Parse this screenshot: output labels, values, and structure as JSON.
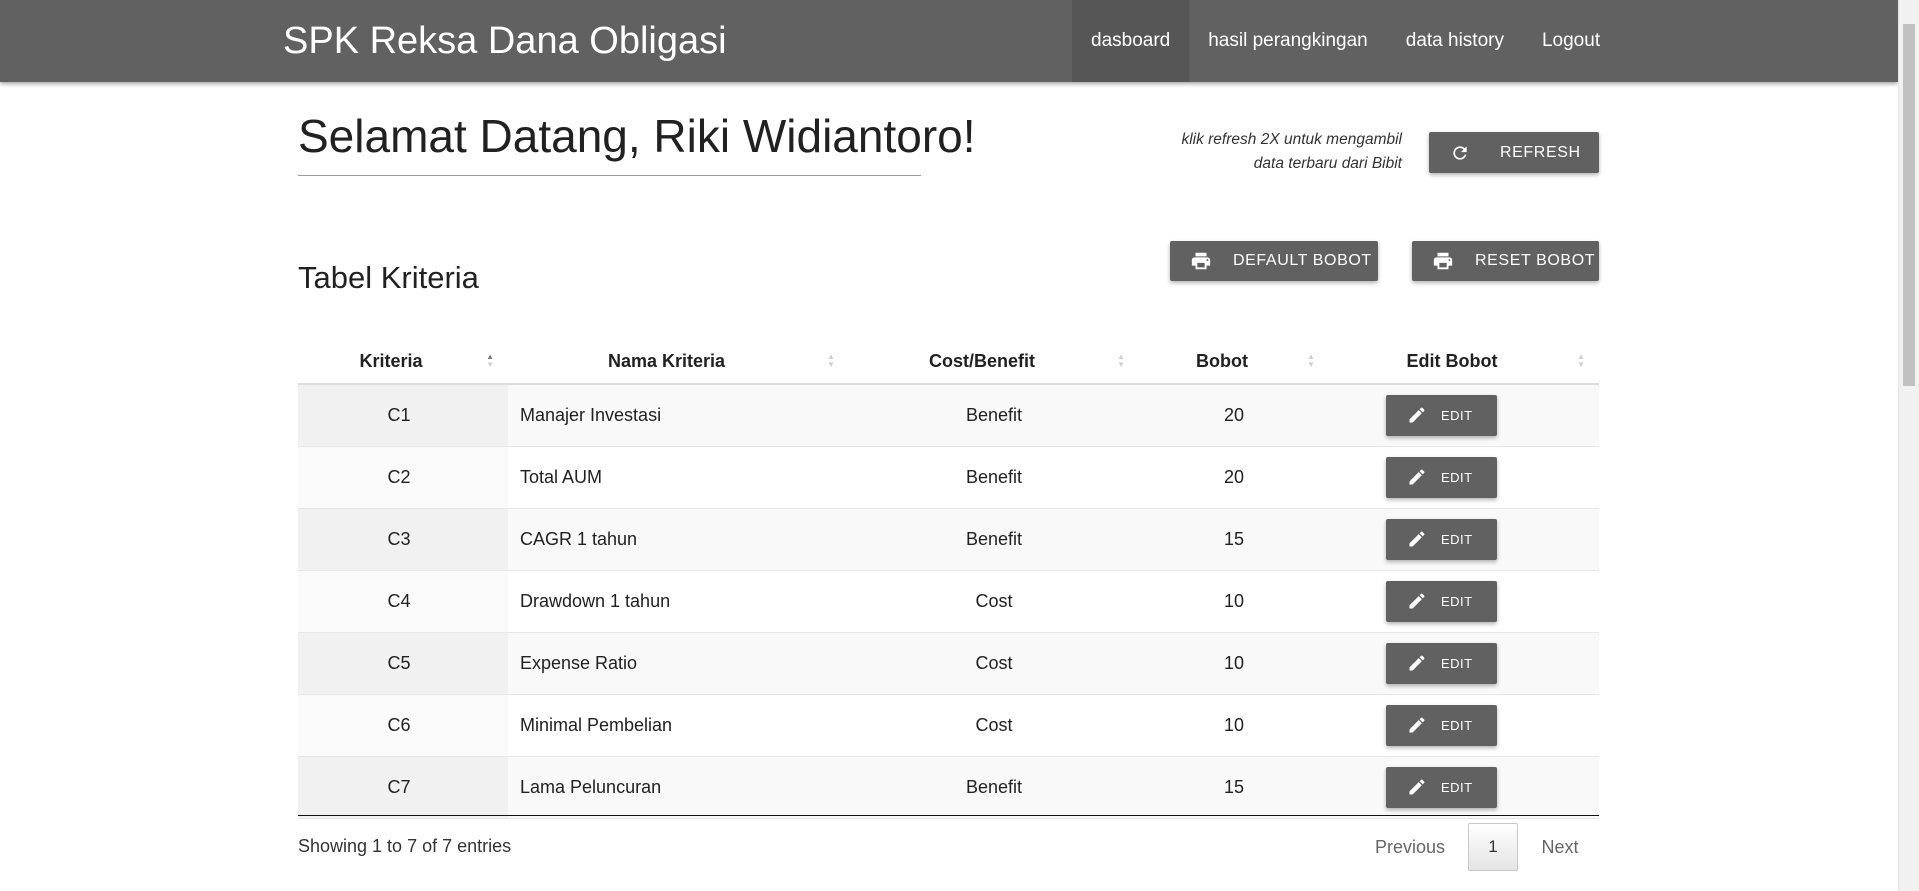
{
  "navbar": {
    "brand": "SPK Reksa Dana Obligasi",
    "items": [
      {
        "label": "dasboard",
        "active": true
      },
      {
        "label": "hasil perangkingan",
        "active": false
      },
      {
        "label": "data history",
        "active": false
      },
      {
        "label": "Logout",
        "active": false
      }
    ]
  },
  "welcome": {
    "title": "Selamat Datang, Riki Widiantoro!"
  },
  "refresh": {
    "note_line1": "klik refresh 2X untuk mengambil",
    "note_line2": "data terbaru dari Bibit",
    "button_label": "REFRESH",
    "icon": "refresh-icon"
  },
  "bobot_buttons": {
    "default_label": "DEFAULT BOBOT",
    "reset_label": "RESET BOBOT",
    "icon": "print-icon"
  },
  "section": {
    "title": "Tabel Kriteria"
  },
  "table": {
    "headers": [
      "Kriteria",
      "Nama Kriteria",
      "Cost/Benefit",
      "Bobot",
      "Edit Bobot"
    ],
    "sorted_column": "Kriteria",
    "sort_direction": "ascending",
    "edit_label": "EDIT",
    "edit_icon": "pencil-icon",
    "rows": [
      {
        "kode": "C1",
        "nama": "Manajer Investasi",
        "jenis": "Benefit",
        "bobot": "20"
      },
      {
        "kode": "C2",
        "nama": "Total AUM",
        "jenis": "Benefit",
        "bobot": "20"
      },
      {
        "kode": "C3",
        "nama": "CAGR 1 tahun",
        "jenis": "Benefit",
        "bobot": "15"
      },
      {
        "kode": "C4",
        "nama": "Drawdown 1 tahun",
        "jenis": "Cost",
        "bobot": "10"
      },
      {
        "kode": "C5",
        "nama": "Expense Ratio",
        "jenis": "Cost",
        "bobot": "10"
      },
      {
        "kode": "C6",
        "nama": "Minimal Pembelian",
        "jenis": "Cost",
        "bobot": "10"
      },
      {
        "kode": "C7",
        "nama": "Lama Peluncuran",
        "jenis": "Benefit",
        "bobot": "15"
      }
    ]
  },
  "footer": {
    "info": "Showing 1 to 7 of 7 entries",
    "previous": "Previous",
    "page": "1",
    "next": "Next"
  },
  "colors": {
    "navbar": "#616161",
    "button": "#616161",
    "active_nav": "#565656"
  }
}
